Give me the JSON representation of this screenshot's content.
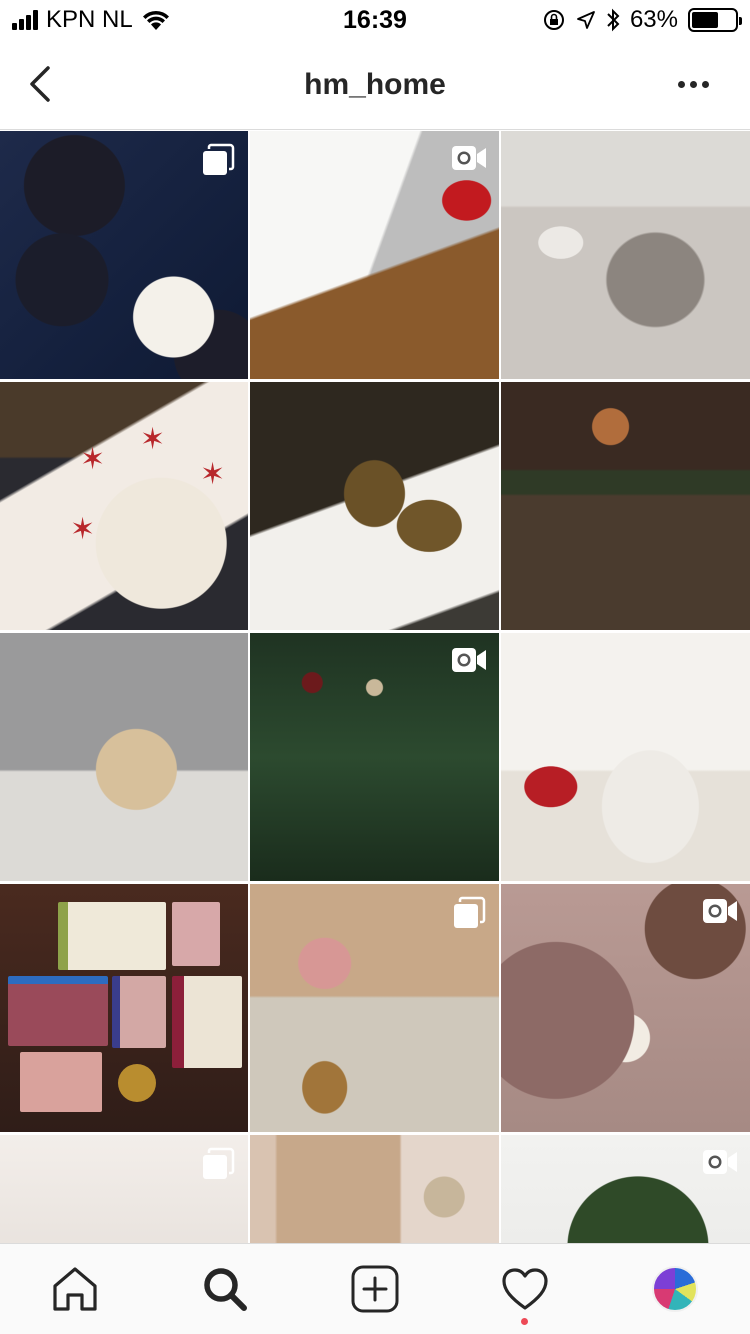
{
  "status_bar": {
    "carrier": "KPN NL",
    "time": "16:39",
    "battery_percent": "63%",
    "battery_level": 0.63,
    "icons": [
      "signal-icon",
      "wifi-icon",
      "orientation-lock-icon",
      "location-arrow-icon",
      "bluetooth-icon",
      "battery-icon"
    ]
  },
  "header": {
    "title": "hm_home",
    "back_icon": "chevron-left-icon",
    "more_icon": "more-dots-icon"
  },
  "grid": {
    "tiles": [
      {
        "badge": "multiple-posts-icon"
      },
      {
        "badge": "video-icon"
      },
      {
        "badge": ""
      },
      {
        "badge": ""
      },
      {
        "badge": ""
      },
      {
        "badge": ""
      },
      {
        "badge": ""
      },
      {
        "badge": "video-icon"
      },
      {
        "badge": ""
      },
      {
        "badge": ""
      },
      {
        "badge": "multiple-posts-icon"
      },
      {
        "badge": "video-icon"
      },
      {
        "badge": "multiple-posts-icon"
      },
      {
        "badge": ""
      },
      {
        "badge": "video-icon"
      }
    ]
  },
  "tab_bar": {
    "tabs": [
      {
        "icon": "home-icon",
        "active": false
      },
      {
        "icon": "search-icon",
        "active": true
      },
      {
        "icon": "add-post-icon",
        "active": false
      },
      {
        "icon": "heart-icon",
        "active": false,
        "has_notification": true
      },
      {
        "icon": "profile-avatar",
        "active": false
      }
    ],
    "notification_color": "#ed4956"
  },
  "colors": {
    "text": "#262626",
    "divider": "#dbdbdb",
    "tab_bar_bg": "#fafafa"
  }
}
